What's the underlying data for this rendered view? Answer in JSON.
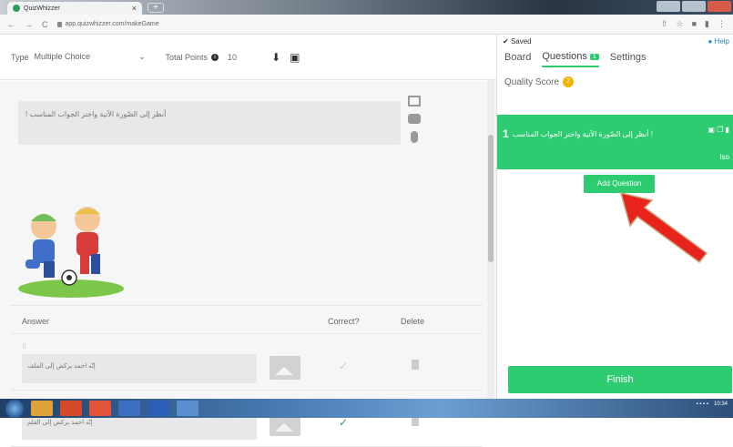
{
  "browser": {
    "tab_title": "QuizWhizzer",
    "url": "app.quizwhizzer.com/makeGame",
    "new_tab": "+",
    "tab_close": "×"
  },
  "editor": {
    "type_label": "Type",
    "type_value": "Multiple Choice",
    "type_caret": "⌄",
    "points_label": "Total Points",
    "points_value": "10",
    "question_text": "أنظر إلى الصّورة الآتية واختر الجواب المناسب !",
    "answers_header": {
      "answer": "Answer",
      "correct": "Correct?",
      "delete": "Delete"
    },
    "answers": [
      {
        "text": "إنّه احمد يركض إلى الملف",
        "correct": false
      },
      {
        "text": "إنّه احمد يركض إلى القلم",
        "correct": true
      }
    ]
  },
  "panel": {
    "saved": "Saved",
    "help": "Help",
    "tabs": [
      {
        "label": "Board"
      },
      {
        "label": "Questions",
        "badge": "1"
      },
      {
        "label": "Settings"
      }
    ],
    "quality_label": "Quality Score",
    "quality_value": "2",
    "question_card": {
      "num": "1",
      "text": "أنظر إلى الصّورة الآتية واختر الجواب المناسب !",
      "meta": "Iso"
    },
    "add_question": "Add Question",
    "finish": "Finish"
  },
  "taskbar": {
    "clock": "10:34"
  },
  "colors": {
    "accent": "#2ecc71",
    "arrow": "#e8231c"
  }
}
